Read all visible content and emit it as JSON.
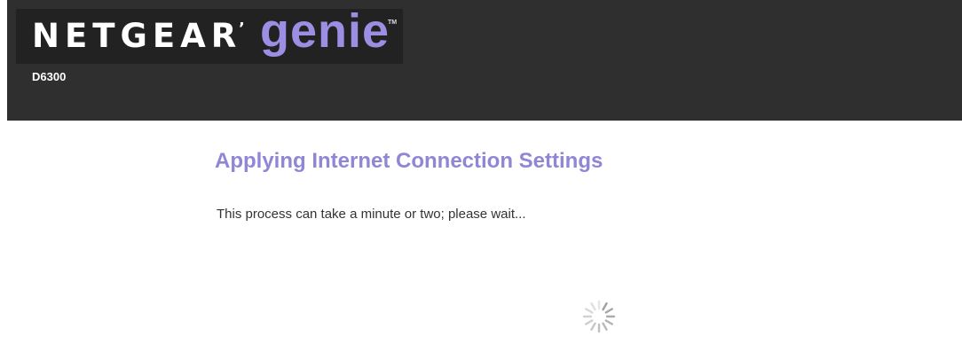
{
  "header": {
    "brand_name": "NETGEAR",
    "brand_dot": "’",
    "product_name": "genie",
    "trademark": "TM",
    "model": "D6300"
  },
  "main": {
    "title": "Applying Internet Connection Settings",
    "message": "This process can take a minute or two; please wait..."
  },
  "colors": {
    "header_bg": "#2f2f2f",
    "genie_purple": "#9c8fe3",
    "title_purple": "#8f86d6",
    "spinner_gray": "#9a9a9a"
  },
  "icons": {
    "spinner": "loading-spinner-icon"
  }
}
